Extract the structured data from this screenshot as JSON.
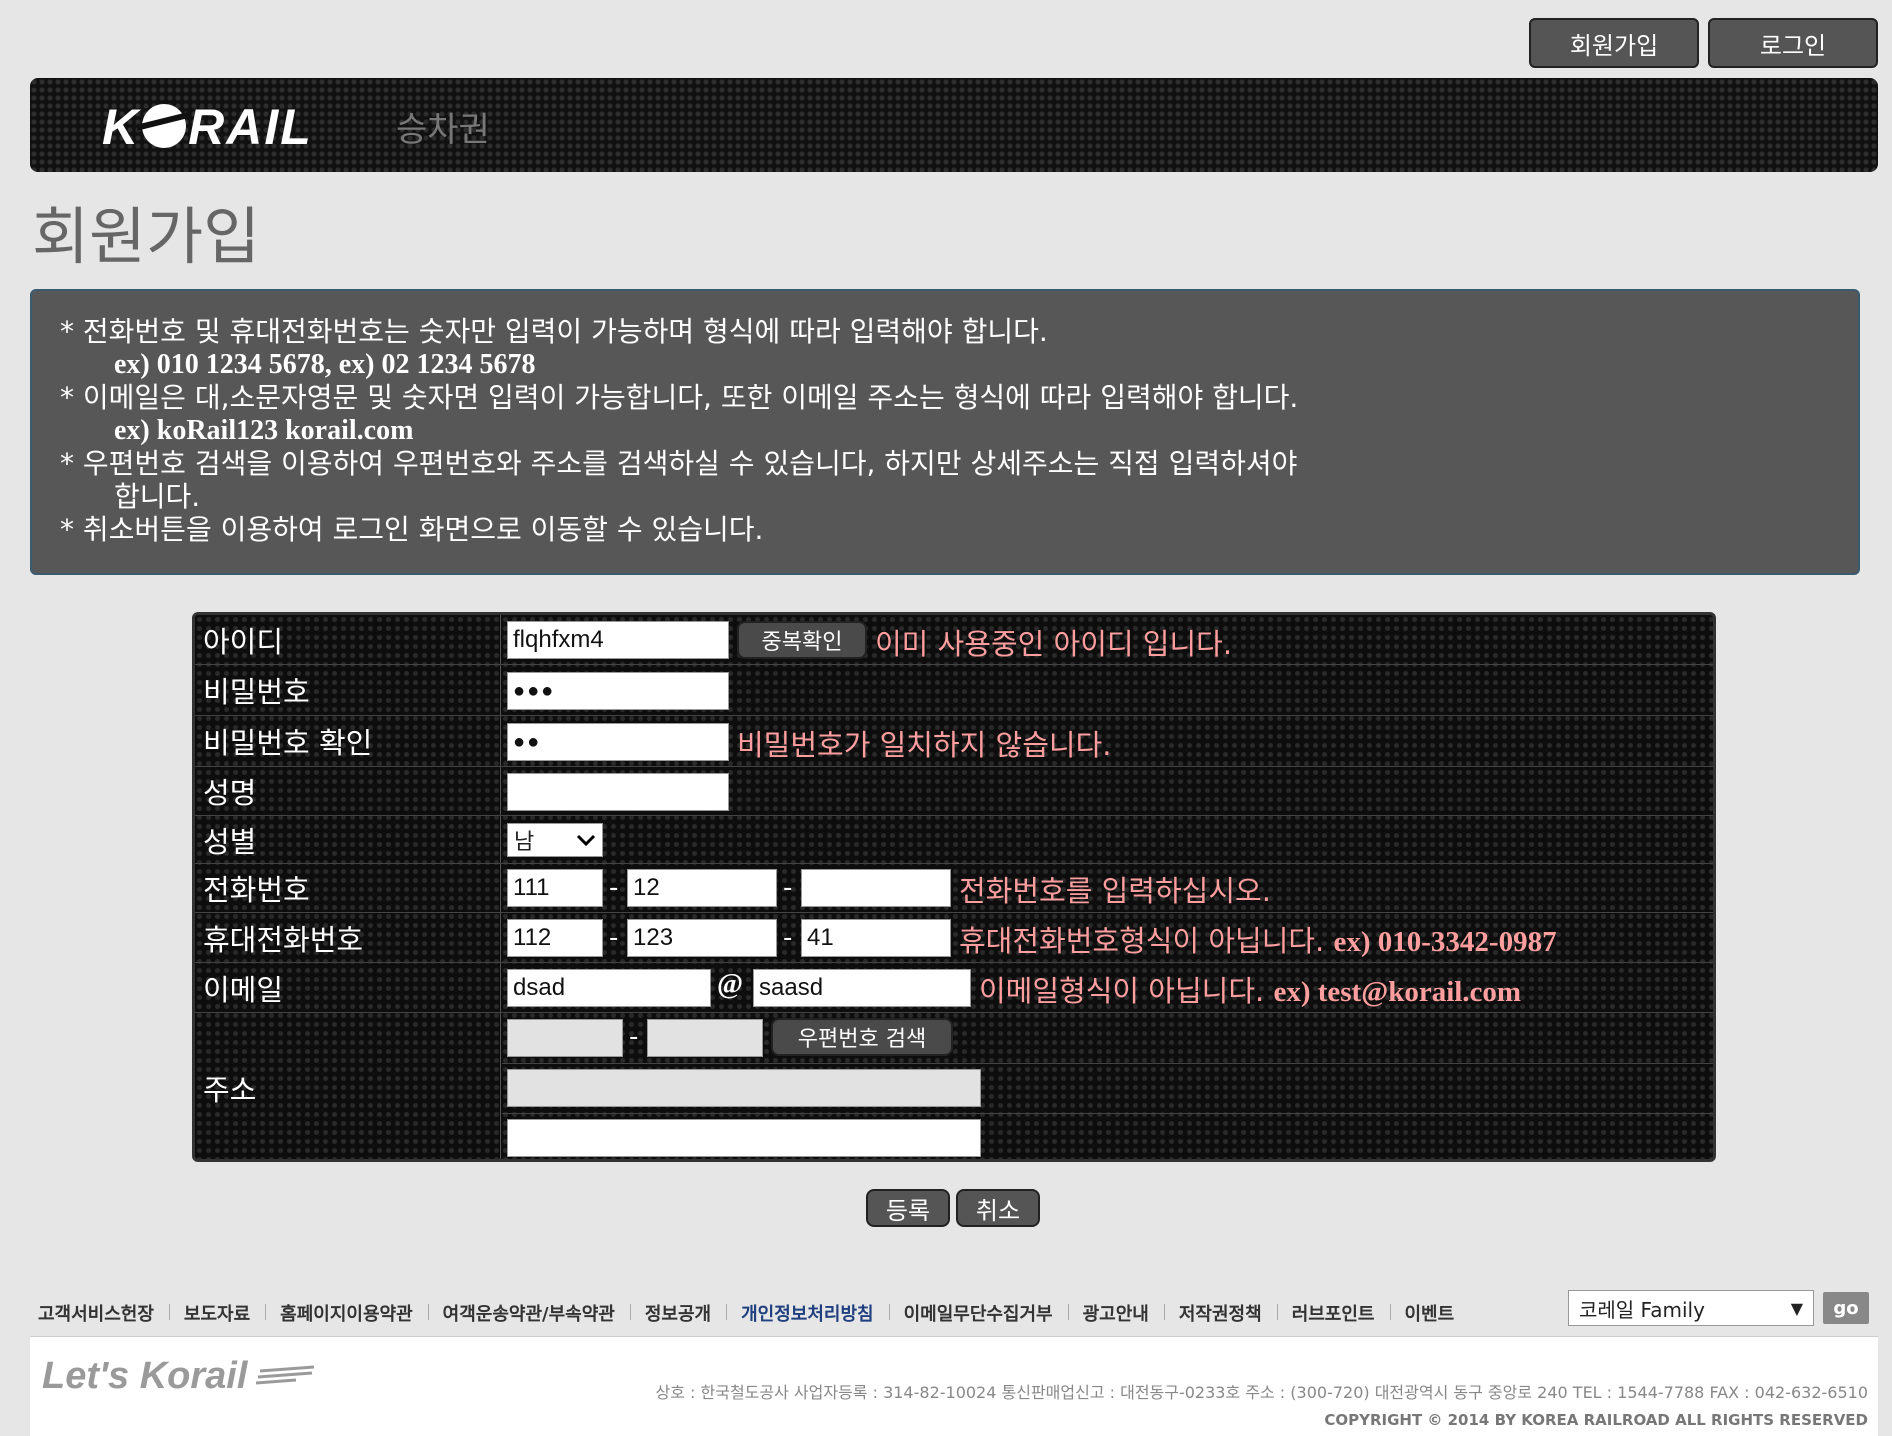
{
  "top_buttons": {
    "join": "회원가입",
    "login": "로그인"
  },
  "header": {
    "logo": "KORAIL",
    "nav_ticket": "승차권"
  },
  "page_title": "회원가입",
  "notice": {
    "line1": "* 전화번호 및 휴대전화번호는 숫자만 입력이 가능하며 형식에 따라 입력해야 합니다.",
    "line1_ex": "ex) 010 1234 5678, ex) 02 1234 5678",
    "line2": "* 이메일은 대,소문자영문 및 숫자면 입력이 가능합니다, 또한 이메일 주소는 형식에 따라 입력해야 합니다.",
    "line2_ex": "ex) koRail123 korail.com",
    "line3": "* 우편번호 검색을 이용하여 우편번호와 주소를 검색하실 수 있습니다, 하지만 상세주소는 직접 입력하셔야",
    "line3_cont": "합니다.",
    "line4": "* 취소버튼을 이용하여 로그인 화면으로 이동할 수 있습니다."
  },
  "form": {
    "id": {
      "label": "아이디",
      "value": "flqhfxm4",
      "button": "중복확인",
      "message": "이미 사용중인 아이디 입니다."
    },
    "password": {
      "label": "비밀번호",
      "value": "●●●"
    },
    "password_confirm": {
      "label": "비밀번호 확인",
      "value": "●●",
      "message": "비밀번호가 일치하지 않습니다."
    },
    "name": {
      "label": "성명",
      "value": ""
    },
    "gender": {
      "label": "성별",
      "selected": "남"
    },
    "phone": {
      "label": "전화번호",
      "part1": "111",
      "part2": "12",
      "part3": "",
      "separator": "-",
      "message": "전화번호를 입력하십시오."
    },
    "mobile": {
      "label": "휴대전화번호",
      "part1": "112",
      "part2": "123",
      "part3": "41",
      "separator": "-",
      "message": "휴대전화번호형식이 아닙니다.",
      "message_ex": "ex) 010-3342-0987"
    },
    "email": {
      "label": "이메일",
      "local": "dsad",
      "at": "@",
      "domain": "saasd",
      "message": "이메일형식이 아닙니다.",
      "message_ex": "ex) test@korail.com"
    },
    "address": {
      "label": "주소",
      "zip1": "",
      "zip2": "",
      "separator": "-",
      "zip_button": "우편번호 검색",
      "line1": "",
      "line2": ""
    }
  },
  "actions": {
    "submit": "등록",
    "cancel": "취소"
  },
  "footer": {
    "links": [
      "고객서비스헌장",
      "보도자료",
      "홈페이지이용약관",
      "여객운송약관/부속약관",
      "정보공개",
      "개인정보처리방침",
      "이메일무단수집거부",
      "광고안내",
      "저작권정책",
      "러브포인트",
      "이벤트"
    ],
    "family_select": "코레일 Family",
    "go": "go",
    "logo": "Let's Korail",
    "info": "상호 : 한국철도공사    사업자등록 : 314-82-10024    통신판매업신고 : 대전동구-0233호    주소 : (300-720) 대전광역시 동구 중앙로 240    TEL : 1544-7788    FAX : 042-632-6510",
    "copyright": "COPYRIGHT © 2014 BY KOREA RAILROAD  ALL RIGHTS RESERVED"
  }
}
